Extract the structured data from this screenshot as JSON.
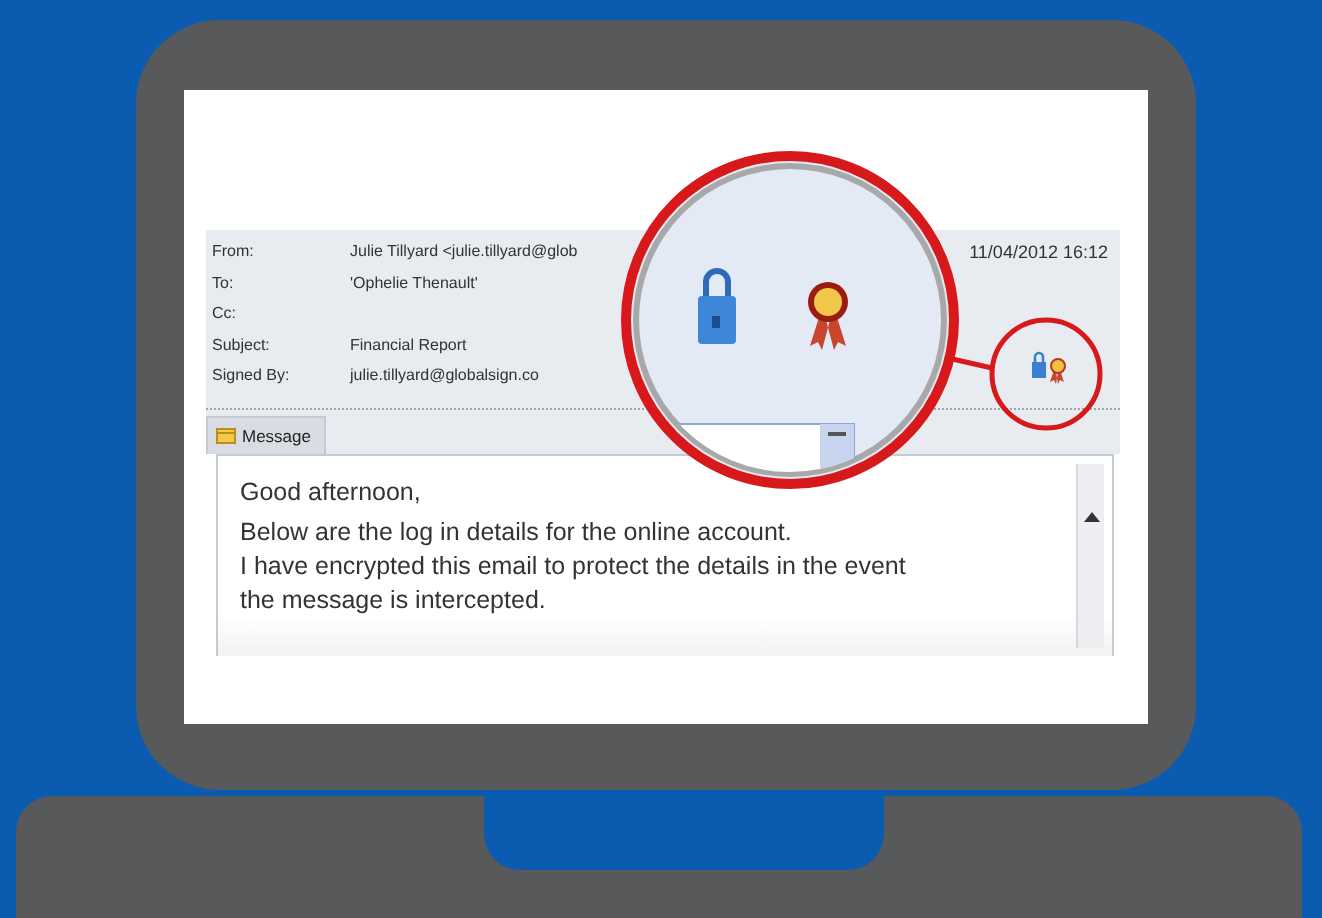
{
  "email_header": {
    "fields": [
      {
        "label": "From:",
        "value": "Julie Tillyard <julie.tillyard@glob"
      },
      {
        "label": "To:",
        "value": "'Ophelie Thenault'"
      },
      {
        "label": "Cc:"
      },
      {
        "label": "Subject:",
        "value": "Financial Report"
      },
      {
        "label": "Signed By:",
        "value": "julie.tillyard@globalsign.co"
      }
    ],
    "sent": "11/04/2012 16:12"
  },
  "tab": {
    "label": "Message"
  },
  "body": {
    "lines": [
      "Good afternoon,",
      "Below are the log in details for the online account.",
      "I have encrypted this email to protect the details in the event",
      "the message is intercepted."
    ]
  }
}
